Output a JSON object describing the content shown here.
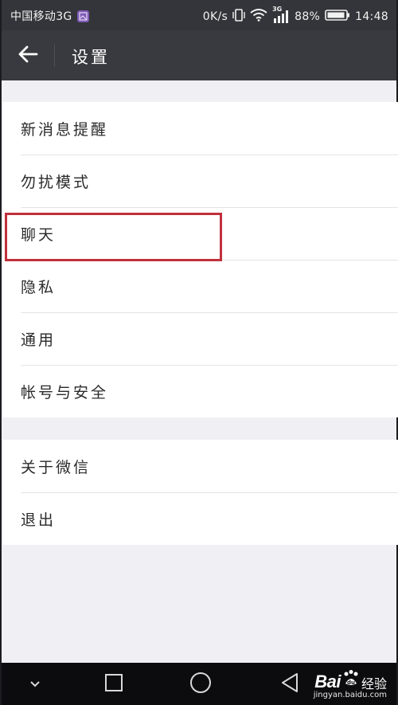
{
  "status_bar": {
    "carrier": "中国移动3G",
    "speed": "0K/s",
    "network": "3G",
    "battery": "88%",
    "time": "14:48"
  },
  "title_bar": {
    "back_icon": "arrow-left-icon",
    "title": "设置"
  },
  "groups": [
    {
      "items": [
        {
          "label": "新消息提醒"
        },
        {
          "label": "勿扰模式"
        },
        {
          "label": "聊天"
        },
        {
          "label": "隐私"
        },
        {
          "label": "通用"
        },
        {
          "label": "帐号与安全"
        }
      ]
    },
    {
      "items": [
        {
          "label": "关于微信"
        },
        {
          "label": "退出"
        }
      ]
    }
  ],
  "nav_bar": {
    "icons": [
      "chevron-down-icon",
      "recents-square-icon",
      "home-circle-icon",
      "back-triangle-icon"
    ]
  },
  "watermark": {
    "brand": "Bai",
    "brand_suffix": "经验",
    "url": "jingyan.baidu.com"
  },
  "colors": {
    "status_bar_bg": "#34353a",
    "title_bar_bg": "#393a3f",
    "page_bg": "#f0eff4",
    "highlight": "#c0303c"
  }
}
